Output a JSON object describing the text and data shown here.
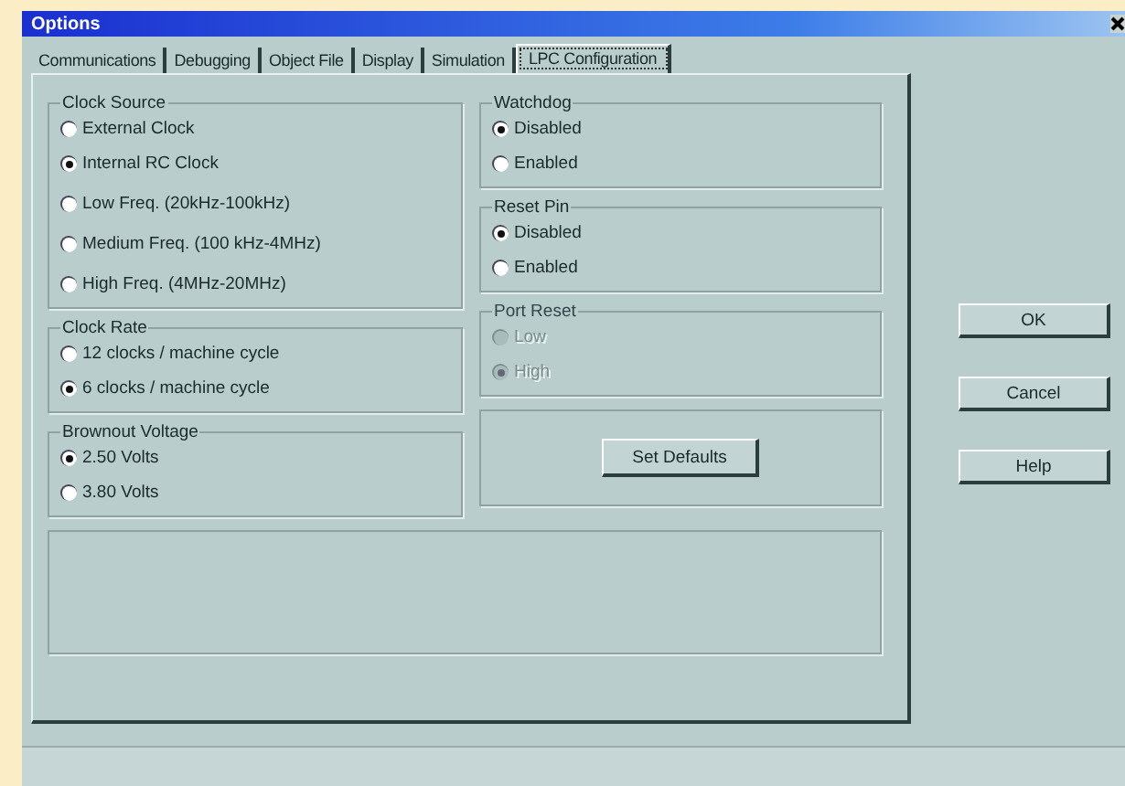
{
  "window": {
    "title": "Options"
  },
  "tabs": [
    {
      "label": "Communications",
      "selected": false
    },
    {
      "label": "Debugging",
      "selected": false
    },
    {
      "label": "Object File",
      "selected": false
    },
    {
      "label": "Display",
      "selected": false
    },
    {
      "label": "Simulation",
      "selected": false
    },
    {
      "label": "LPC Configuration",
      "selected": true
    }
  ],
  "left_groups": [
    {
      "title": "Clock Source",
      "disabled": false,
      "options": [
        {
          "label": "External Clock",
          "selected": false
        },
        {
          "label": "Internal RC Clock",
          "selected": true
        },
        {
          "label": "Low Freq. (20kHz-100kHz)",
          "selected": false
        },
        {
          "label": "Medium Freq. (100 kHz-4MHz)",
          "selected": false
        },
        {
          "label": "High Freq. (4MHz-20MHz)",
          "selected": false
        }
      ]
    },
    {
      "title": "Clock Rate",
      "disabled": false,
      "options": [
        {
          "label": "12 clocks / machine cycle",
          "selected": false
        },
        {
          "label": " 6 clocks / machine cycle",
          "selected": true
        }
      ]
    },
    {
      "title": "Brownout Voltage",
      "disabled": false,
      "options": [
        {
          "label": "2.50 Volts",
          "selected": true
        },
        {
          "label": "3.80 Volts",
          "selected": false
        }
      ]
    }
  ],
  "right_groups": [
    {
      "title": "Watchdog",
      "disabled": false,
      "options": [
        {
          "label": "Disabled",
          "selected": true
        },
        {
          "label": "Enabled",
          "selected": false
        }
      ]
    },
    {
      "title": "Reset Pin",
      "disabled": false,
      "options": [
        {
          "label": "Disabled",
          "selected": true
        },
        {
          "label": "Enabled",
          "selected": false
        }
      ]
    },
    {
      "title": "Port Reset",
      "disabled": true,
      "options": [
        {
          "label": "Low",
          "selected": false
        },
        {
          "label": "High",
          "selected": true
        }
      ]
    }
  ],
  "set_defaults": "Set Defaults",
  "buttons": [
    "OK",
    "Cancel",
    "Help"
  ]
}
